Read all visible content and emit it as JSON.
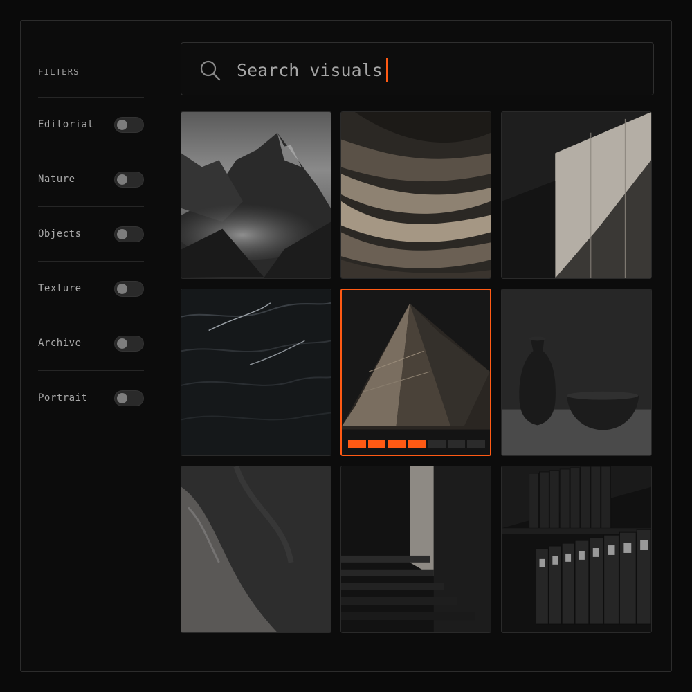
{
  "sidebar": {
    "title": "FILTERS",
    "filters": [
      {
        "label": "Editorial",
        "enabled": false
      },
      {
        "label": "Nature",
        "enabled": false
      },
      {
        "label": "Objects",
        "enabled": false
      },
      {
        "label": "Texture",
        "enabled": false
      },
      {
        "label": "Archive",
        "enabled": false
      },
      {
        "label": "Portrait",
        "enabled": false
      }
    ]
  },
  "search": {
    "placeholder": "Search visuals",
    "value": "",
    "icon": "search-icon"
  },
  "gallery": {
    "tiles": [
      {
        "subject": "misty-mountain-peaks"
      },
      {
        "subject": "layered-rock-texture"
      },
      {
        "subject": "concrete-wall-light"
      },
      {
        "subject": "dark-ocean-waves"
      },
      {
        "subject": "rock-pyramid",
        "selected": true,
        "progress_segments_filled": 4,
        "progress_segments_total": 7
      },
      {
        "subject": "ceramic-vase-and-bowl"
      },
      {
        "subject": "peeling-concrete-wall"
      },
      {
        "subject": "shadowed-staircase"
      },
      {
        "subject": "archive-binder-shelves"
      }
    ]
  },
  "colors": {
    "accent": "#ff5a14",
    "background": "#0a0a0a",
    "border": "#2c2c2c"
  }
}
